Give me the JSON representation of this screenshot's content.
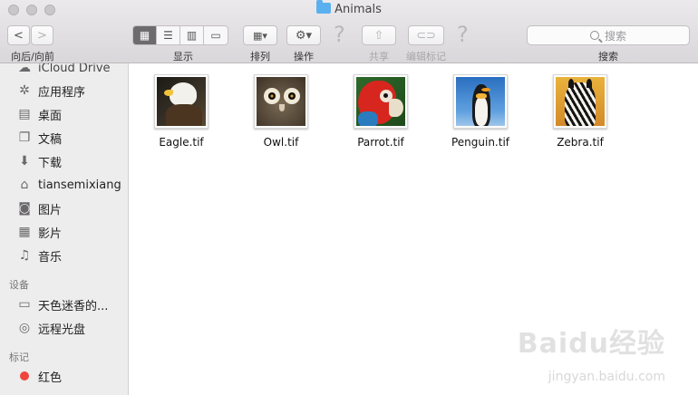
{
  "window": {
    "title": "Animals"
  },
  "toolbar": {
    "back_label": "<",
    "forward_label": ">",
    "nav_label": "向后/向前",
    "view_label": "显示",
    "arrange_label": "排列",
    "action_label": "操作",
    "share_label": "共享",
    "tags_label": "编辑标记",
    "search_label": "搜索",
    "search_placeholder": "搜索",
    "help_glyph": "?"
  },
  "sidebar": {
    "items_top": [
      {
        "label": "iCloud Drive",
        "icon": "cloud-icon"
      },
      {
        "label": "应用程序",
        "icon": "applications-icon"
      },
      {
        "label": "桌面",
        "icon": "desktop-icon"
      },
      {
        "label": "文稿",
        "icon": "documents-icon"
      },
      {
        "label": "下载",
        "icon": "downloads-icon"
      },
      {
        "label": "tiansemixiang",
        "icon": "home-icon"
      },
      {
        "label": "图片",
        "icon": "pictures-icon"
      },
      {
        "label": "影片",
        "icon": "movies-icon"
      },
      {
        "label": "音乐",
        "icon": "music-icon"
      }
    ],
    "devices_header": "设备",
    "devices": [
      {
        "label": "天色迷香的...",
        "icon": "laptop-icon"
      },
      {
        "label": "远程光盘",
        "icon": "disc-icon"
      }
    ],
    "tags_header": "标记",
    "tags": [
      {
        "label": "红色",
        "icon": "red-tag-icon",
        "color": "#f0443d"
      }
    ]
  },
  "files": [
    {
      "name": "Eagle.tif"
    },
    {
      "name": "Owl.tif"
    },
    {
      "name": "Parrot.tif"
    },
    {
      "name": "Penguin.tif"
    },
    {
      "name": "Zebra.tif"
    }
  ],
  "watermark": {
    "brand": "Baidu经验",
    "url": "jingyan.baidu.com"
  }
}
